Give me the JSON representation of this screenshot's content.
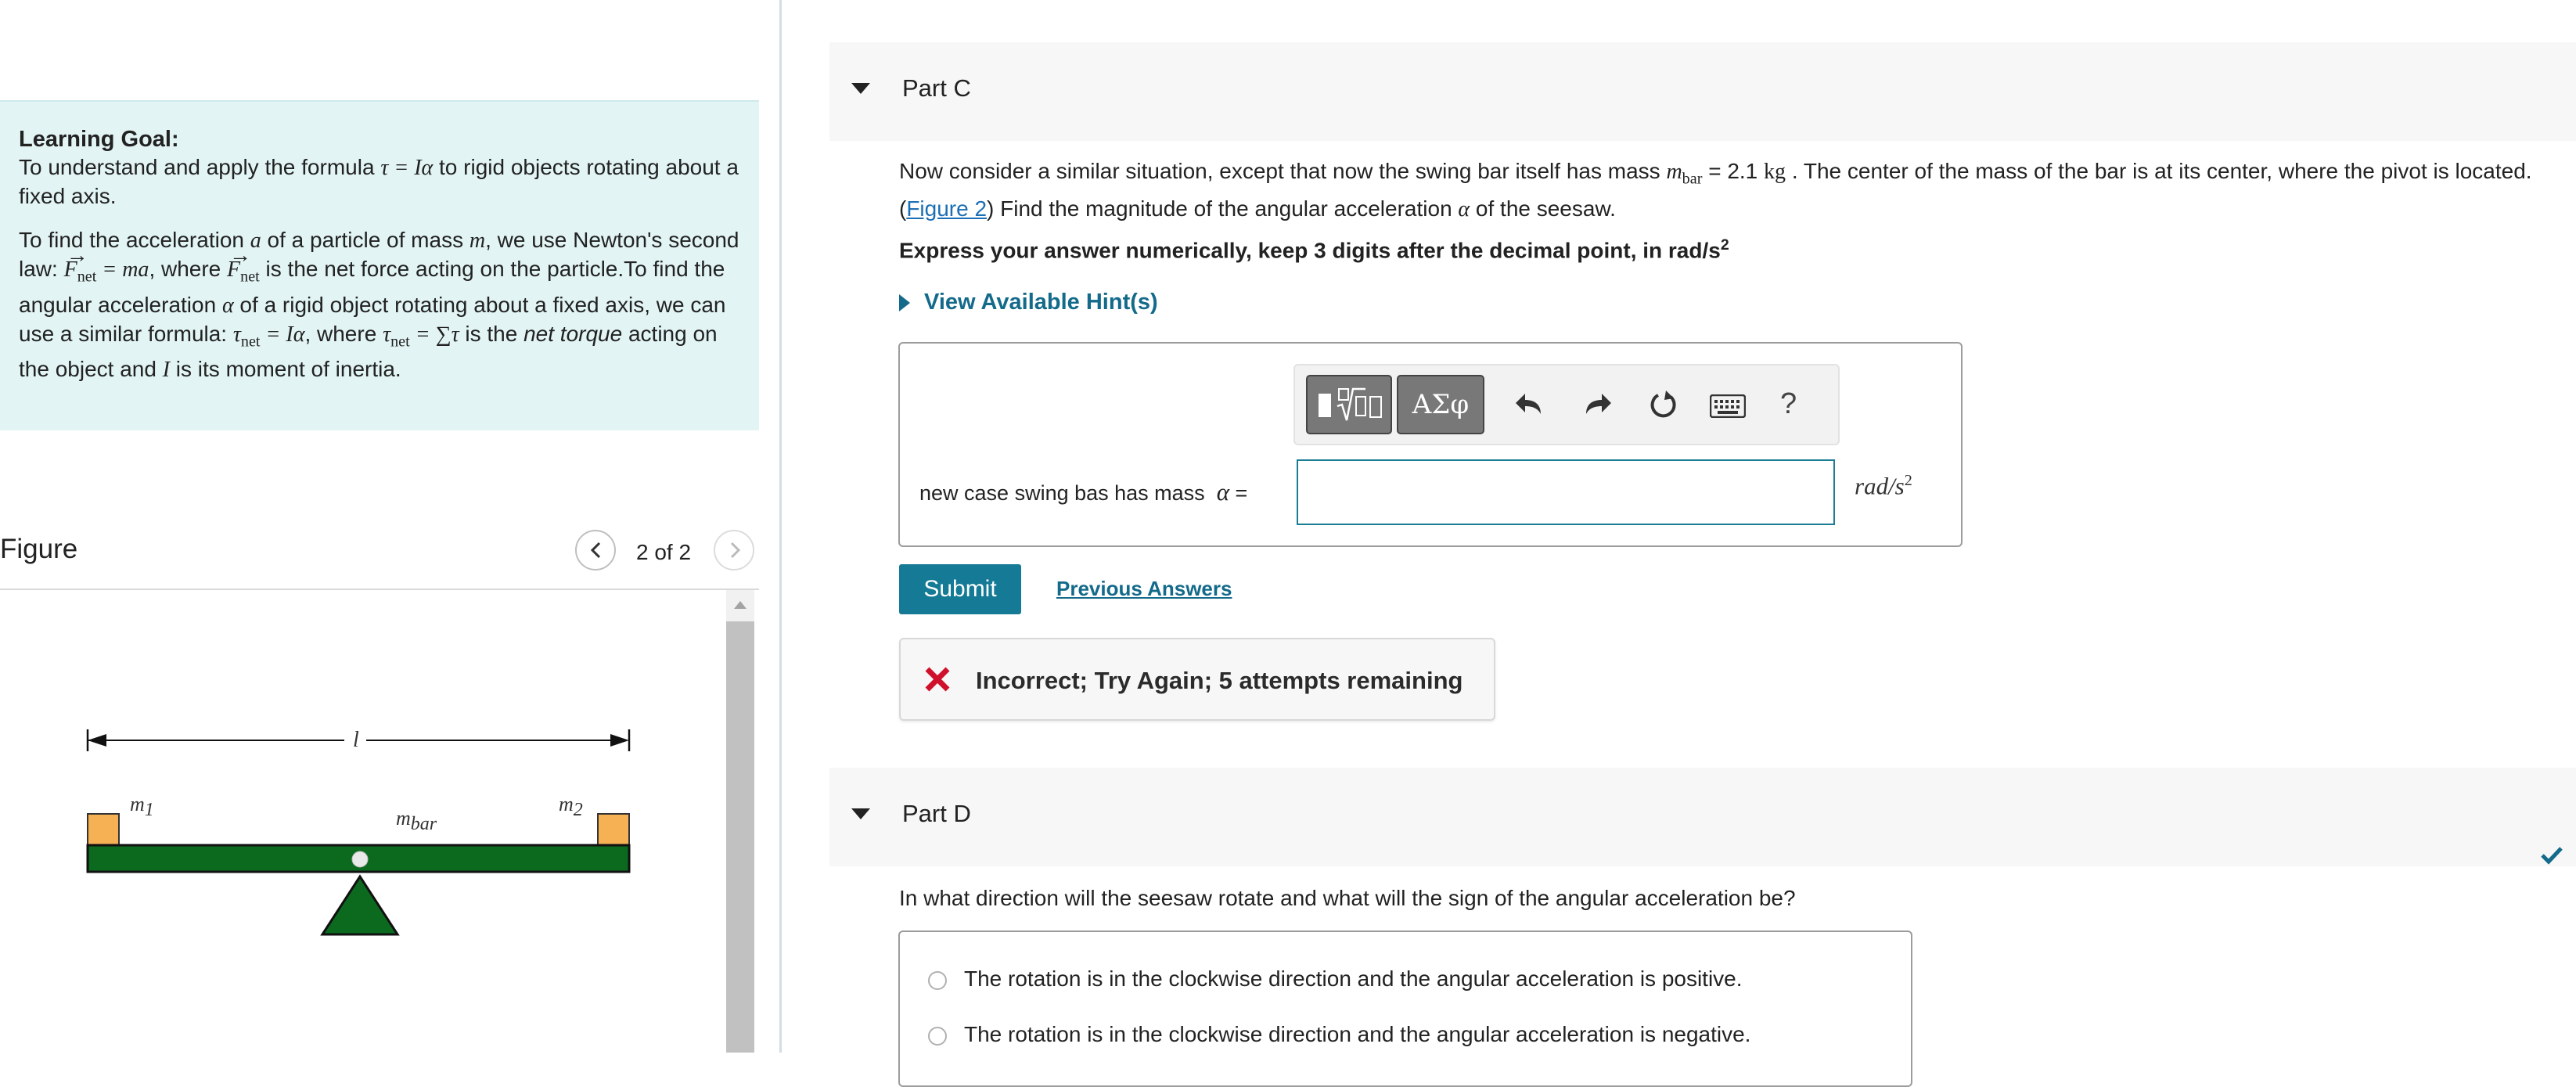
{
  "learning_goal": {
    "heading": "Learning Goal:",
    "line1_pre": "To understand and apply the formula ",
    "line1_formula": "τ = Iα",
    "line1_post": " to rigid objects rotating about a fixed axis.",
    "para2": {
      "t1": "To find the acceleration ",
      "a": "a",
      "t2": " of a particle of mass ",
      "m": "m",
      "t3": ", we use Newton's second law: ",
      "f_net": "F",
      "net_sub": "net",
      "eq": " = ma",
      "t4": ", where ",
      "t5": " is the net force acting on the particle.To find the angular acceleration ",
      "alpha": "α",
      "t6": " of a rigid object rotating about a fixed axis, we can use a similar formula: ",
      "tau": "τ",
      "eq2": " = Iα",
      "t7": ", where ",
      "eq3": " = ∑τ",
      "t8": " is the ",
      "net_torque": "net torque",
      "t9": " acting on the object and ",
      "I": "I",
      "t10": " is its moment of inertia."
    }
  },
  "figure": {
    "title": "Figure",
    "counter": "2 of 2",
    "labels": {
      "length": "l",
      "m1": "m",
      "m1_sub": "1",
      "mbar": "m",
      "mbar_sub": "bar",
      "m2": "m",
      "m2_sub": "2"
    },
    "colors": {
      "bar": "#0c6a1e",
      "mass": "#f5b153",
      "pivot": "#0c6a1e"
    }
  },
  "part_c": {
    "label": "Part C",
    "text_pre": "Now consider a similar situation, except that now the swing bar itself has mass ",
    "mass_var": "m",
    "mass_sub": "bar",
    "mass_value": " = 2.1 ",
    "mass_unit": "kg",
    "text_mid": " . The center of the mass of the bar is at its center, where the pivot is located. (",
    "figure_link": "Figure 2",
    "text_post": ") Find the magnitude of the angular acceleration ",
    "alpha": "α",
    "text_end": " of the seesaw.",
    "express": "Express your answer numerically, keep 3 digits after the decimal point, in rad/s",
    "express_sup": "2",
    "hints": "View Available Hint(s)",
    "toolbar": {
      "symbols": "ΑΣφ",
      "help": "?"
    },
    "input_label": "new case swing bas has mass",
    "input_var": "α",
    "input_eq": " =",
    "input_value": "",
    "unit": "rad/s",
    "unit_sup": "2",
    "submit": "Submit",
    "previous_answers": "Previous Answers",
    "feedback": "Incorrect; Try Again; 5 attempts remaining"
  },
  "part_d": {
    "label": "Part D",
    "question": "In what direction will the seesaw rotate and what will the sign of the angular acceleration be?",
    "options": [
      "The rotation is in the clockwise direction and the angular acceleration is positive.",
      "The rotation is in the clockwise direction and the angular acceleration is negative."
    ]
  },
  "colors": {
    "accent": "#147a95",
    "link": "#1c6fb5",
    "error": "#d0112b",
    "goal_bg": "#e2f4f4"
  }
}
